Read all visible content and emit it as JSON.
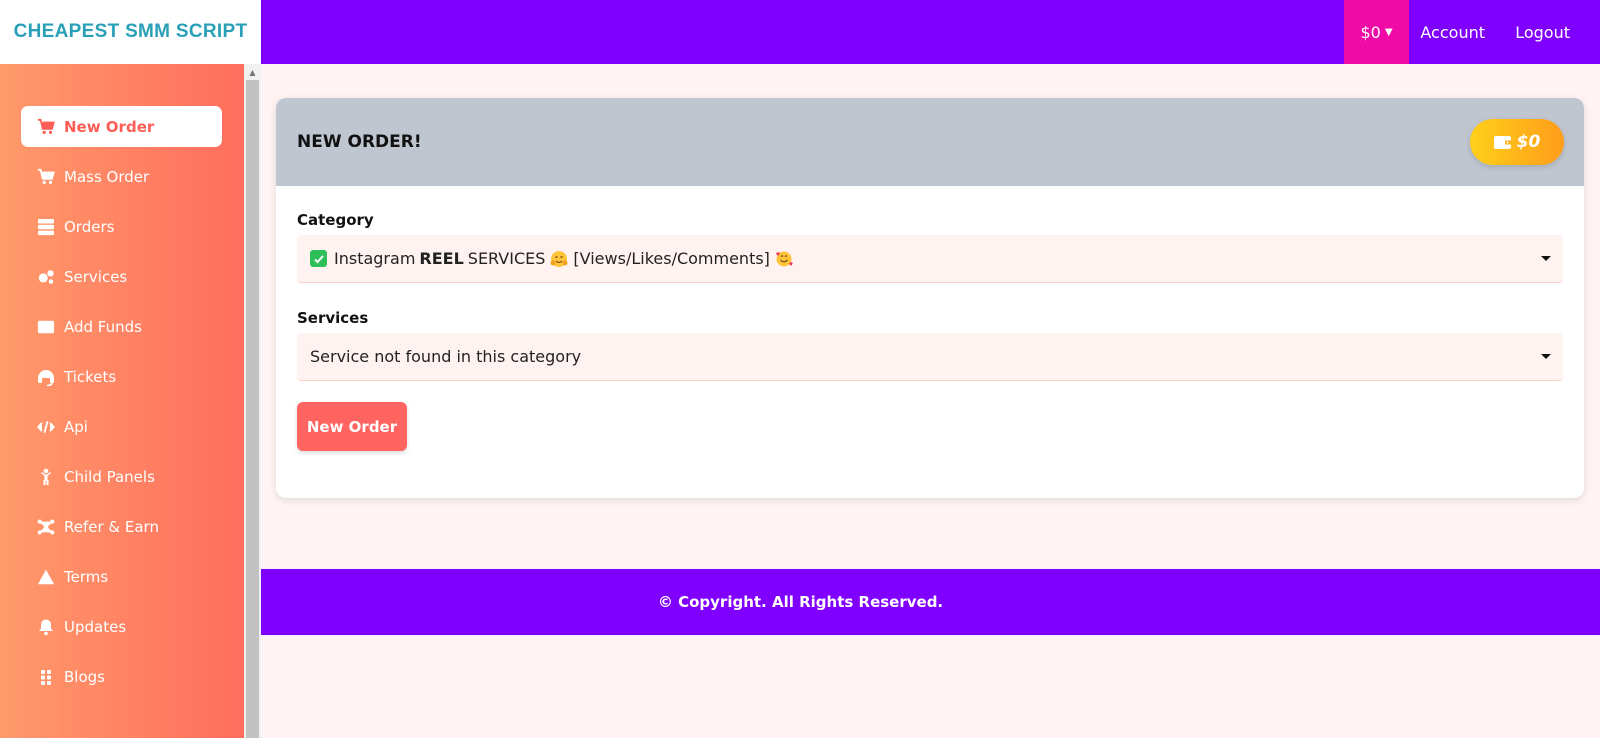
{
  "brand": {
    "logo_text": "CHEAPEST SMM SCRIPT"
  },
  "topbar": {
    "balance": "$0",
    "links": [
      "Account",
      "Logout"
    ]
  },
  "sidebar": {
    "items": [
      {
        "label": "New Order",
        "icon": "cart-plus-icon",
        "active": true
      },
      {
        "label": "Mass Order",
        "icon": "cart-arrow-icon"
      },
      {
        "label": "Orders",
        "icon": "server-icon"
      },
      {
        "label": "Services",
        "icon": "cogs-icon"
      },
      {
        "label": "Add Funds",
        "icon": "credit-card-icon"
      },
      {
        "label": "Tickets",
        "icon": "headset-icon"
      },
      {
        "label": "Api",
        "icon": "code-icon"
      },
      {
        "label": "Child Panels",
        "icon": "child-icon"
      },
      {
        "label": "Refer & Earn",
        "icon": "network-icon"
      },
      {
        "label": "Terms",
        "icon": "warning-icon"
      },
      {
        "label": "Updates",
        "icon": "bell-icon"
      },
      {
        "label": "Blogs",
        "icon": "grid-icon"
      }
    ]
  },
  "card": {
    "title": "NEW ORDER!",
    "wallet_balance": "$0",
    "category": {
      "label": "Category",
      "value_prefix": "Instagram",
      "value_bold": "REEL",
      "value_rest": "SERVICES",
      "value_suffix": "[Views/Likes/Comments]"
    },
    "services": {
      "label": "Services",
      "value": "Service not found in this category"
    },
    "submit_label": "New Order"
  },
  "footer": {
    "text": "© Copyright. All Rights Reserved."
  },
  "colors": {
    "topbar": "#8000ff",
    "balance_bg": "#f10ba6",
    "sidebar_start": "#ff9a6a",
    "sidebar_end": "#ff6d5e",
    "accent": "#ff6461"
  }
}
